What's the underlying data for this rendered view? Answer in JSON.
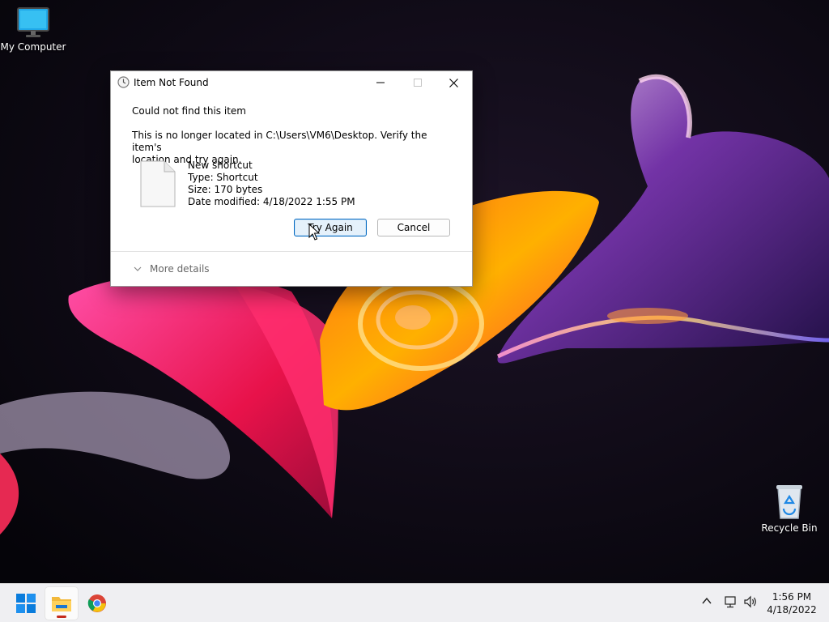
{
  "desktop": {
    "icons": [
      {
        "label": "My Computer",
        "icon": "monitor-icon"
      },
      {
        "label": "Recycle Bin",
        "icon": "recycle-bin-icon"
      }
    ]
  },
  "dialog": {
    "title": "Item Not Found",
    "title_icon": "clock-icon",
    "heading": "Could not find this item",
    "message_line1": "This is no longer located in C:\\Users\\VM6\\Desktop. Verify the item's",
    "message_line2": "location and try again.",
    "file": {
      "name": "New shortcut",
      "type": "Type: Shortcut",
      "size": "Size: 170 bytes",
      "modified": "Date modified: 4/18/2022 1:55 PM"
    },
    "buttons": {
      "try_again": "Try Again",
      "cancel": "Cancel"
    },
    "more_details": "More details"
  },
  "taskbar": {
    "apps": [
      "start-icon",
      "file-explorer-icon",
      "chrome-icon"
    ],
    "tray": [
      "chevron-up-icon",
      "network-icon",
      "volume-icon"
    ],
    "time": "1:56 PM",
    "date": "4/18/2022"
  },
  "colors": {
    "accent": "#0067c0",
    "taskbar": "#efeff2",
    "desktop_bg": "#07060d"
  }
}
